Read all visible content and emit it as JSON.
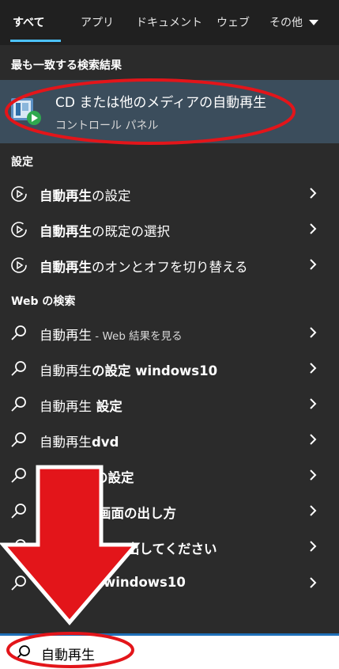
{
  "tabs": [
    "すべて",
    "アプリ",
    "ドキュメント",
    "ウェブ",
    "その他"
  ],
  "sections": {
    "best_match": "最も一致する検索結果",
    "settings": "設定",
    "web": "Web の検索"
  },
  "best_match": {
    "title": "CD または他のメディアの自動再生",
    "subtitle": "コントロール パネル"
  },
  "settings_items": [
    {
      "bold": "自動再生",
      "rest": "の設定"
    },
    {
      "bold": "自動再生",
      "rest": "の既定の選択"
    },
    {
      "bold": "自動再生",
      "rest": "のオンとオフを切り替える"
    }
  ],
  "web_items": [
    {
      "main": "自動再生",
      "suffix": " - Web 結果を見る"
    },
    {
      "main": "自動再生",
      "rest": "の設定 windows10"
    },
    {
      "main": "自動再生",
      "rest": " 設定"
    },
    {
      "main": "自動再生",
      "rest": "dvd"
    },
    {
      "main": "",
      "rest": "の設定"
    },
    {
      "main": "",
      "rest": "画面の出し方"
    },
    {
      "main": "",
      "rest": "出してください"
    },
    {
      "main": "",
      "rest": "windows10"
    }
  ],
  "search": {
    "value": "自動再生"
  },
  "colors": {
    "accent": "#4cc2ff",
    "highlight": "#3b4d5c",
    "annotation_red": "#e3151a",
    "search_border": "#1f6fb8"
  }
}
